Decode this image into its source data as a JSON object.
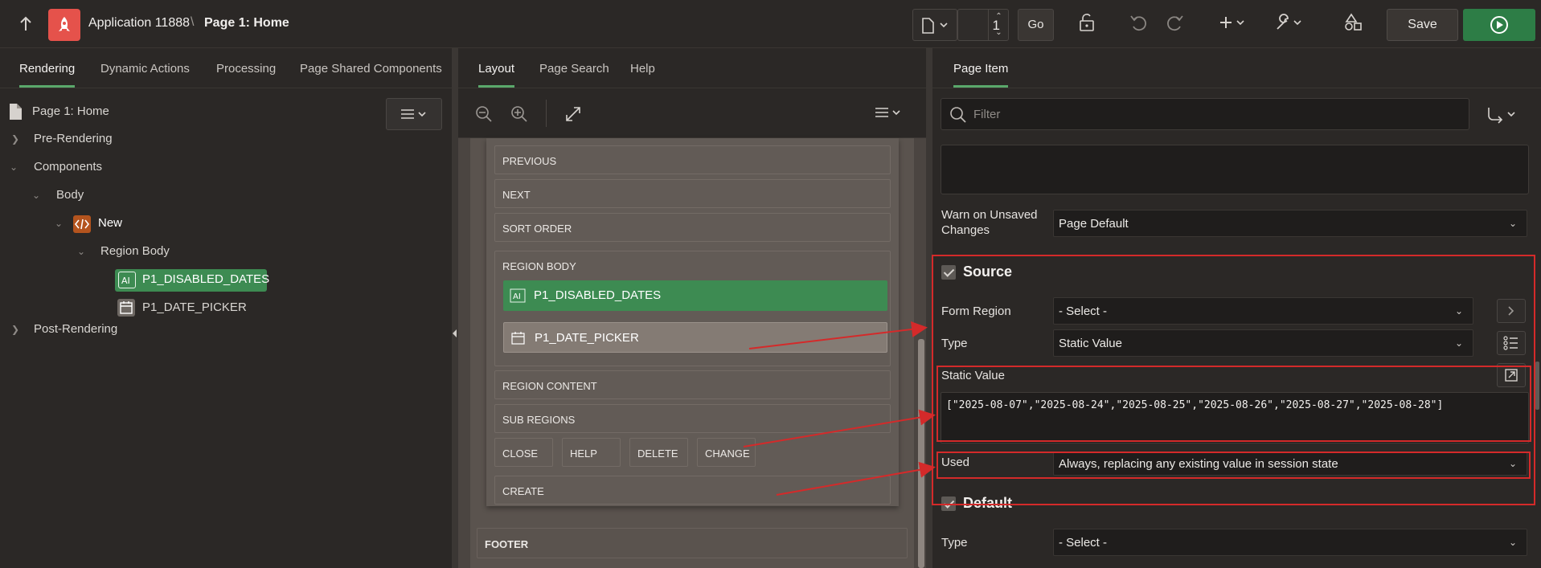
{
  "header": {
    "app_name": "Application 11888",
    "separator": "\\",
    "page_name": "Page 1: Home",
    "page_number": "1",
    "go_label": "Go",
    "save_label": "Save"
  },
  "left": {
    "tabs": [
      "Rendering",
      "Dynamic Actions",
      "Processing",
      "Page Shared Components"
    ],
    "root": "Page 1: Home",
    "tree": {
      "pre_rendering": "Pre-Rendering",
      "components": "Components",
      "body": "Body",
      "new": "New",
      "region_body": "Region Body",
      "item1": "P1_DISABLED_DATES",
      "item2": "P1_DATE_PICKER",
      "post_rendering": "Post-Rendering"
    }
  },
  "middle": {
    "tabs": [
      "Layout",
      "Page Search",
      "Help"
    ],
    "slots": {
      "previous": "PREVIOUS",
      "next": "NEXT",
      "sort_order": "SORT ORDER",
      "region_body": "REGION BODY",
      "item1": "P1_DISABLED_DATES",
      "item2": "P1_DATE_PICKER",
      "region_content": "REGION CONTENT",
      "sub_regions": "SUB REGIONS",
      "close": "CLOSE",
      "help": "HELP",
      "delete": "DELETE",
      "change": "CHANGE",
      "create": "CREATE",
      "footer": "FOOTER"
    }
  },
  "right": {
    "tab": "Page Item",
    "filter_placeholder": "Filter",
    "warn_label": "Warn on Unsaved Changes",
    "warn_value": "Page Default",
    "source_section": "Source",
    "form_region_label": "Form Region",
    "form_region_value": "- Select -",
    "type_label": "Type",
    "type_value": "Static Value",
    "static_value_label": "Static Value",
    "static_value": "[\"2025-08-07\",\"2025-08-24\",\"2025-08-25\",\"2025-08-26\",\"2025-08-27\",\"2025-08-28\"]",
    "used_label": "Used",
    "used_value": "Always, replacing any existing value in session state",
    "default_section": "Default",
    "default_type_label": "Type",
    "default_type_value": "- Select -"
  },
  "colors": {
    "accent_green": "#3d8b52",
    "annotation_red": "#d42a2a",
    "app_logo": "#e5524b"
  }
}
